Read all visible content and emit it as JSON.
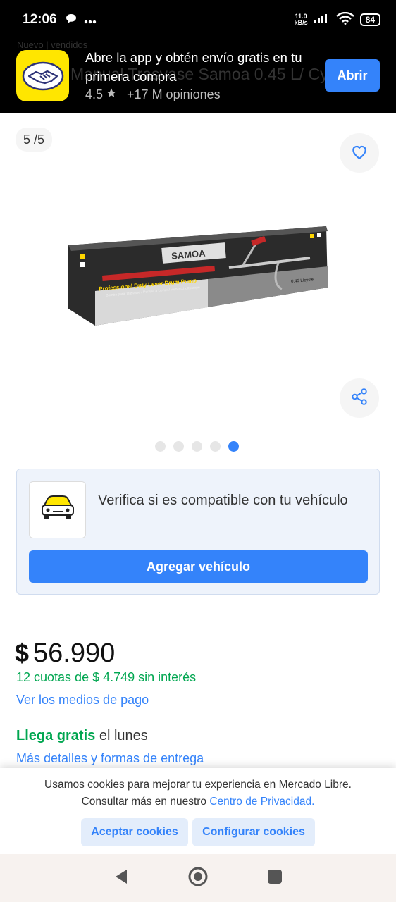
{
  "status_bar": {
    "time": "12:06",
    "net_speed_value": "11.0",
    "net_speed_unit": "kB/s",
    "battery": "84",
    "network": "4G"
  },
  "app_banner": {
    "title": "Abre la app y obtén envío gratis en tu primera compra",
    "rating": "4.5",
    "reviews": "+17 M opiniones",
    "open_label": "Abrir",
    "background_text": "Manual Trasvase Samoa 0.45 L/ Cy",
    "background_top_text": "Nuevo | vendidos",
    "brand_color": "#ffe600",
    "accent_color": "#3483fa"
  },
  "gallery": {
    "counter": "5 /5",
    "dots_total": 5,
    "active_dot": 5,
    "product_brand": "SAMOA",
    "product_box_text": "Professional Duty Lever Drum Pump",
    "product_box_subtext": "Bomba para Trasvase / Pompe à Levier / Hebelschuttpumpe",
    "product_capacity": "0.45 L/cycle"
  },
  "compat": {
    "text": "Verifica si es compatible con tu vehículo",
    "button_label": "Agregar vehículo"
  },
  "price": {
    "currency": "$",
    "amount": "56.990",
    "installments": "12 cuotas de $ 4.749 sin interés",
    "payment_link": "Ver los medios de pago"
  },
  "shipping": {
    "free_label": "Llega gratis",
    "day_label": " el lunes",
    "details_link": "Más detalles y formas de entrega"
  },
  "cookies": {
    "line1": "Usamos cookies para mejorar tu experiencia en Mercado Libre.",
    "line2_prefix": "Consultar más en nuestro ",
    "line2_link": "Centro de Privacidad.",
    "accept_label": "Aceptar cookies",
    "config_label": "Configurar cookies"
  }
}
